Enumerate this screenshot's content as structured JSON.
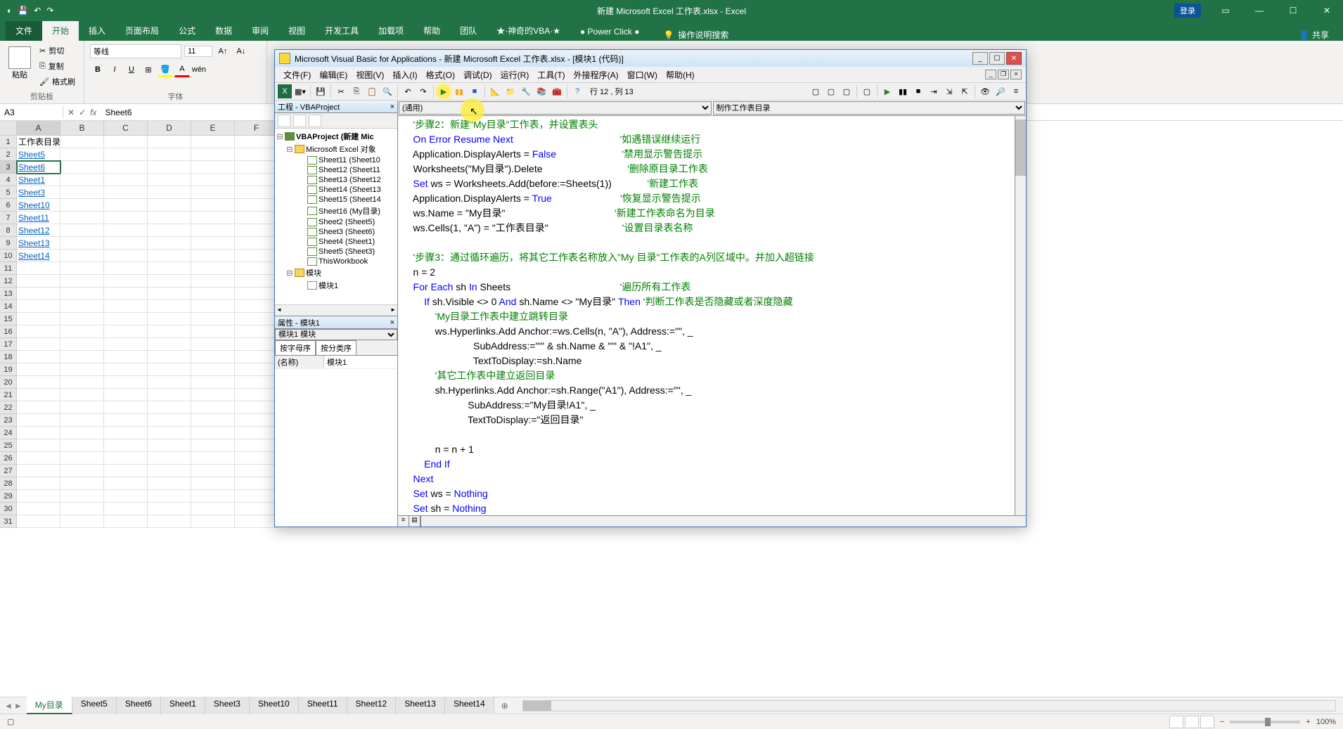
{
  "app": {
    "title": "新建 Microsoft Excel 工作表.xlsx - Excel",
    "login": "登录",
    "share": "共享"
  },
  "ribbon_tabs": [
    "文件",
    "开始",
    "插入",
    "页面布局",
    "公式",
    "数据",
    "审阅",
    "视图",
    "开发工具",
    "加载项",
    "帮助",
    "团队",
    "★·神奇的VBA·★",
    "● Power Click ●"
  ],
  "tell_me": "操作说明搜索",
  "clipboard": {
    "label": "剪贴板",
    "paste": "粘贴",
    "cut": "剪切",
    "copy": "复制",
    "painter": "格式刷"
  },
  "font": {
    "label": "字体",
    "name": "等线",
    "size": "11"
  },
  "name_box": "A3",
  "formula": "Sheet6",
  "cells": {
    "a1": "工作表目录",
    "rows": [
      "Sheet5",
      "Sheet6",
      "Sheet1",
      "Sheet3",
      "Sheet10",
      "Sheet11",
      "Sheet12",
      "Sheet13",
      "Sheet14"
    ]
  },
  "columns": [
    "A",
    "B",
    "C",
    "D",
    "E",
    "F"
  ],
  "sheet_tabs": [
    "My目录",
    "Sheet5",
    "Sheet6",
    "Sheet1",
    "Sheet3",
    "Sheet10",
    "Sheet11",
    "Sheet12",
    "Sheet13",
    "Sheet14"
  ],
  "status": {
    "ready": "",
    "zoom": "100%"
  },
  "vba": {
    "title": "Microsoft Visual Basic for Applications - 新建 Microsoft Excel 工作表.xlsx - [模块1 (代码)]",
    "menus": [
      "文件(F)",
      "编辑(E)",
      "视图(V)",
      "插入(I)",
      "格式(O)",
      "调试(D)",
      "运行(R)",
      "工具(T)",
      "外接程序(A)",
      "窗口(W)",
      "帮助(H)"
    ],
    "pos": "行 12 , 列 13",
    "project_title": "工程 - VBAProject",
    "project_root": "VBAProject (新建 Mic",
    "project_folder": "Microsoft Excel 对象",
    "sheets": [
      "Sheet11 (Sheet10",
      "Sheet12 (Sheet11",
      "Sheet13 (Sheet12",
      "Sheet14 (Sheet13",
      "Sheet15 (Sheet14",
      "Sheet16 (My目录)",
      "Sheet2 (Sheet5)",
      "Sheet3 (Sheet6)",
      "Sheet4 (Sheet1)",
      "Sheet5 (Sheet3)"
    ],
    "thisworkbook": "ThisWorkbook",
    "modules_label": "模块",
    "module1": "模块1",
    "props_title": "属性 - 模块1",
    "props_combo": "模块1 模块",
    "props_tab_alpha": "按字母序",
    "props_tab_cat": "按分类序",
    "prop_name_k": "(名称)",
    "prop_name_v": "模块1",
    "left_dd": "(通用)",
    "right_dd": "制作工作表目录",
    "code": [
      {
        "t": "cm",
        "v": "    '步骤2：新建\"My目录\"工作表，并设置表头"
      },
      {
        "t": "mix",
        "v": [
          {
            "t": "kw",
            "v": "    On Error Resume Next"
          },
          {
            "t": "cm",
            "v": "                                       '如遇错误继续运行"
          }
        ]
      },
      {
        "t": "mix",
        "v": [
          {
            "t": "st",
            "v": "    Application.DisplayAlerts = "
          },
          {
            "t": "kw",
            "v": "False"
          },
          {
            "t": "cm",
            "v": "                        '禁用显示警告提示"
          }
        ]
      },
      {
        "t": "mix",
        "v": [
          {
            "t": "st",
            "v": "    Worksheets(\"My目录\").Delete"
          },
          {
            "t": "cm",
            "v": "                               '删除原目录工作表"
          }
        ]
      },
      {
        "t": "mix",
        "v": [
          {
            "t": "kw",
            "v": "    Set "
          },
          {
            "t": "st",
            "v": "ws = Worksheets.Add(before:=Sheets(1))"
          },
          {
            "t": "cm",
            "v": "             '新建工作表"
          }
        ]
      },
      {
        "t": "mix",
        "v": [
          {
            "t": "st",
            "v": "    Application.DisplayAlerts = "
          },
          {
            "t": "kw",
            "v": "True"
          },
          {
            "t": "cm",
            "v": "                         '恢复显示警告提示"
          }
        ]
      },
      {
        "t": "mix",
        "v": [
          {
            "t": "st",
            "v": "    ws.Name = \"My目录\""
          },
          {
            "t": "cm",
            "v": "                                        '新建工作表命名为目录"
          }
        ]
      },
      {
        "t": "mix",
        "v": [
          {
            "t": "st",
            "v": "    ws.Cells(1, \"A\") = \"工作表目录\""
          },
          {
            "t": "cm",
            "v": "                           '设置目录表名称"
          }
        ]
      },
      {
        "t": "st",
        "v": ""
      },
      {
        "t": "cm",
        "v": "    '步骤3：通过循环遍历，将其它工作表名称放入\"My 目录\"工作表的A列区域中。并加入超链接"
      },
      {
        "t": "st",
        "v": "    n = 2"
      },
      {
        "t": "mix",
        "v": [
          {
            "t": "kw",
            "v": "    For Each "
          },
          {
            "t": "st",
            "v": "sh "
          },
          {
            "t": "kw",
            "v": "In "
          },
          {
            "t": "st",
            "v": "Sheets"
          },
          {
            "t": "cm",
            "v": "                                        '遍历所有工作表"
          }
        ]
      },
      {
        "t": "mix",
        "v": [
          {
            "t": "kw",
            "v": "        If "
          },
          {
            "t": "st",
            "v": "sh.Visible <> 0 "
          },
          {
            "t": "kw",
            "v": "And "
          },
          {
            "t": "st",
            "v": "sh.Name <> \"My目录\" "
          },
          {
            "t": "kw",
            "v": "Then "
          },
          {
            "t": "cm",
            "v": "'判断工作表是否隐藏或者深度隐藏"
          }
        ]
      },
      {
        "t": "cm",
        "v": "            'My目录工作表中建立跳转目录"
      },
      {
        "t": "st",
        "v": "            ws.Hyperlinks.Add Anchor:=ws.Cells(n, \"A\"), Address:=\"\", _"
      },
      {
        "t": "st",
        "v": "                          SubAddress:=\"'\" & sh.Name & \"'\" & \"!A1\", _"
      },
      {
        "t": "st",
        "v": "                          TextToDisplay:=sh.Name"
      },
      {
        "t": "cm",
        "v": "            '其它工作表中建立返回目录"
      },
      {
        "t": "st",
        "v": "            sh.Hyperlinks.Add Anchor:=sh.Range(\"A1\"), Address:=\"\", _"
      },
      {
        "t": "st",
        "v": "                        SubAddress:=\"My目录!A1\", _"
      },
      {
        "t": "st",
        "v": "                        TextToDisplay:=\"返回目录\""
      },
      {
        "t": "st",
        "v": ""
      },
      {
        "t": "st",
        "v": "            n = n + 1"
      },
      {
        "t": "kw",
        "v": "        End If"
      },
      {
        "t": "kw",
        "v": "    Next"
      },
      {
        "t": "mix",
        "v": [
          {
            "t": "kw",
            "v": "    Set "
          },
          {
            "t": "st",
            "v": "ws = "
          },
          {
            "t": "kw",
            "v": "Nothing"
          }
        ]
      },
      {
        "t": "mix",
        "v": [
          {
            "t": "kw",
            "v": "    Set "
          },
          {
            "t": "st",
            "v": "sh = "
          },
          {
            "t": "kw",
            "v": "Nothing"
          }
        ]
      }
    ]
  }
}
